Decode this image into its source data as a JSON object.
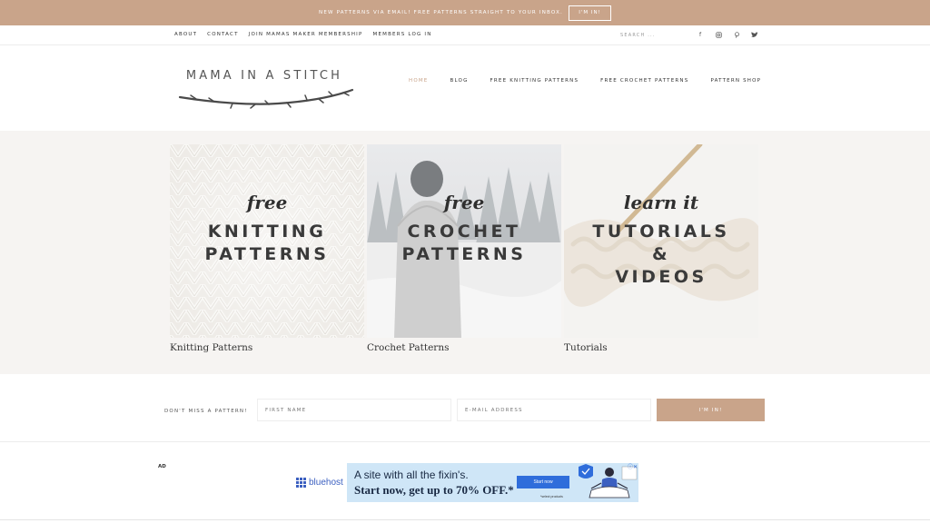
{
  "promo": {
    "text": "NEW PATTERNS VIA EMAIL! FREE PATTERNS STRAIGHT TO YOUR INBOX.",
    "button": "I'M IN!"
  },
  "subnav": {
    "links": [
      "ABOUT",
      "CONTACT",
      "JOIN MAMAS MAKER MEMBERSHIP",
      "MEMBERS LOG IN"
    ],
    "search_placeholder": "SEARCH ..."
  },
  "socials": [
    {
      "icon": "facebook-icon",
      "glyph": "f"
    },
    {
      "icon": "instagram-icon",
      "glyph": "◎"
    },
    {
      "icon": "pinterest-icon",
      "glyph": "℗"
    },
    {
      "icon": "twitter-icon",
      "glyph": "✔"
    }
  ],
  "header": {
    "logo_text": "MAMA IN A STITCH",
    "nav": [
      "HOME",
      "BLOG",
      "FREE KNITTING PATTERNS",
      "FREE CROCHET PATTERNS",
      "PATTERN SHOP"
    ],
    "active": "HOME"
  },
  "cards": [
    {
      "small": "free",
      "big1": "KNITTING",
      "big2": "PATTERNS",
      "big3": "",
      "caption": "Knitting Patterns"
    },
    {
      "small": "free",
      "big1": "CROCHET",
      "big2": "PATTERNS",
      "big3": "",
      "caption": "Crochet Patterns"
    },
    {
      "small": "learn it",
      "big1": "TUTORIALS",
      "big2": "&",
      "big3": "VIDEOS",
      "caption": "Tutorials"
    }
  ],
  "newsletter": {
    "label": "DON'T MISS A PATTERN!",
    "first_name_placeholder": "FIRST NAME",
    "email_placeholder": "E-MAIL ADDRESS",
    "button": "I'M IN!"
  },
  "ad": {
    "label": "AD",
    "brand": "bluehost",
    "headline": "A site with all the fixin's.",
    "subline": "Start now, get up to 70% OFF.*",
    "cta": "Start now",
    "note": "*select products",
    "close": "ⓘ✕"
  },
  "colors": {
    "accent": "#c9a48a",
    "band": "#f6f4f2",
    "bluehost": "#3b5fc0"
  }
}
